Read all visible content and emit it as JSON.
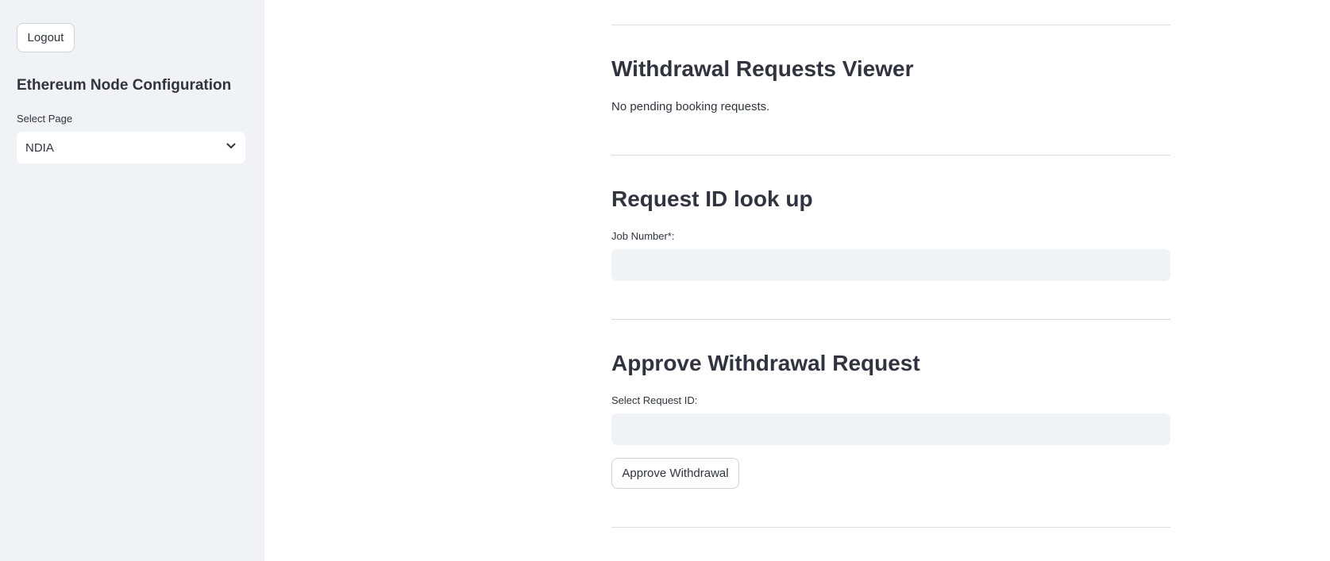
{
  "sidebar": {
    "logout_label": "Logout",
    "title": "Ethereum Node Configuration",
    "select_label": "Select Page",
    "select_value": "NDIA"
  },
  "main": {
    "viewer": {
      "title": "Withdrawal Requests Viewer",
      "message": "No pending booking requests."
    },
    "lookup": {
      "title": "Request ID look up",
      "field_label": "Job Number*:",
      "field_value": ""
    },
    "approve": {
      "title": "Approve Withdrawal Request",
      "field_label": "Select Request ID:",
      "field_value": "",
      "button_label": "Approve Withdrawal"
    }
  }
}
